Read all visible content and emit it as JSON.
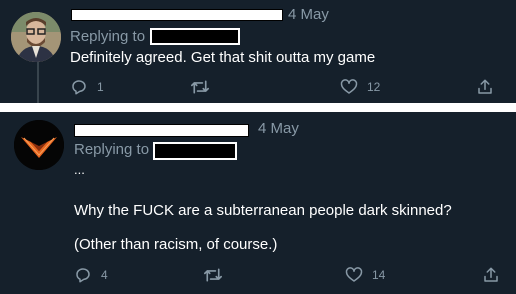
{
  "tweets": [
    {
      "date": "4 May",
      "replying_to_label": "Replying to",
      "text_lines": [
        "Definitely agreed. Get that shit outta my game"
      ],
      "actions": {
        "reply_count": "1",
        "retweet_count": "",
        "like_count": "12"
      }
    },
    {
      "date": "4 May",
      "replying_to_label": "Replying to",
      "text_lines": [
        "...",
        "Why the FUCK are a subterranean people dark skinned?",
        "(Other than racism, of course.)"
      ],
      "actions": {
        "reply_count": "4",
        "retweet_count": "",
        "like_count": "14"
      }
    }
  ],
  "colors": {
    "background": "#15202b",
    "muted_text": "#8899a6",
    "body_text": "#ffffff",
    "separator": "#ffffff",
    "thread_line": "#38444d",
    "logo_accent": "#e8651f"
  },
  "icons": [
    "reply-icon",
    "retweet-icon",
    "like-icon",
    "share-icon"
  ]
}
